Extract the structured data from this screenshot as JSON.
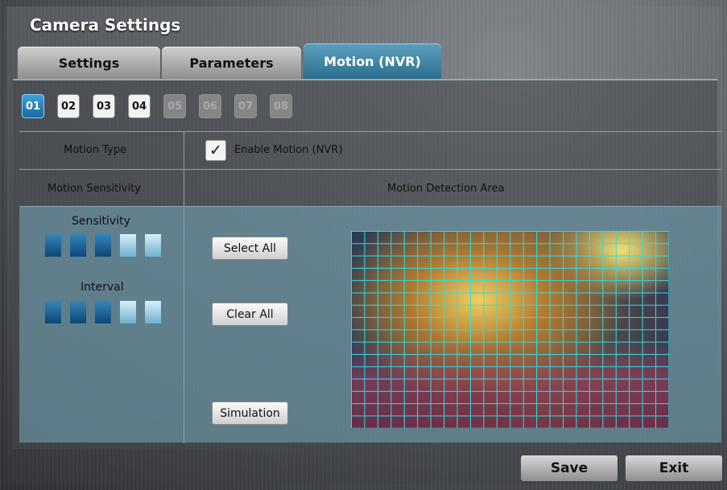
{
  "window": {
    "title": "Camera Settings"
  },
  "tabs": [
    {
      "label": "Settings",
      "active": false
    },
    {
      "label": "Parameters",
      "active": false
    },
    {
      "label": "Motion (NVR)",
      "active": true
    }
  ],
  "channels": [
    {
      "label": "01",
      "state": "active"
    },
    {
      "label": "02",
      "state": "enabled"
    },
    {
      "label": "03",
      "state": "enabled"
    },
    {
      "label": "04",
      "state": "enabled"
    },
    {
      "label": "05",
      "state": "disabled"
    },
    {
      "label": "06",
      "state": "disabled"
    },
    {
      "label": "07",
      "state": "disabled"
    },
    {
      "label": "08",
      "state": "disabled"
    }
  ],
  "motion_type": {
    "label": "Motion Type",
    "checkbox_label": "Enable Motion (NVR)",
    "checked": true
  },
  "sensitivity_section": {
    "header": "Motion Sensitivity",
    "sensitivity_label": "Sensitivity",
    "sensitivity_level": 3,
    "interval_label": "Interval",
    "interval_level": 3,
    "max_level": 5
  },
  "detection_area": {
    "header": "Motion Detection Area",
    "select_all": "Select All",
    "clear_all": "Clear All",
    "simulation": "Simulation",
    "grid_color": "#2be0e6"
  },
  "footer": {
    "save": "Save",
    "exit": "Exit"
  },
  "colors": {
    "accent": "#2c6f8f",
    "active_channel": "#1a6aa0"
  }
}
